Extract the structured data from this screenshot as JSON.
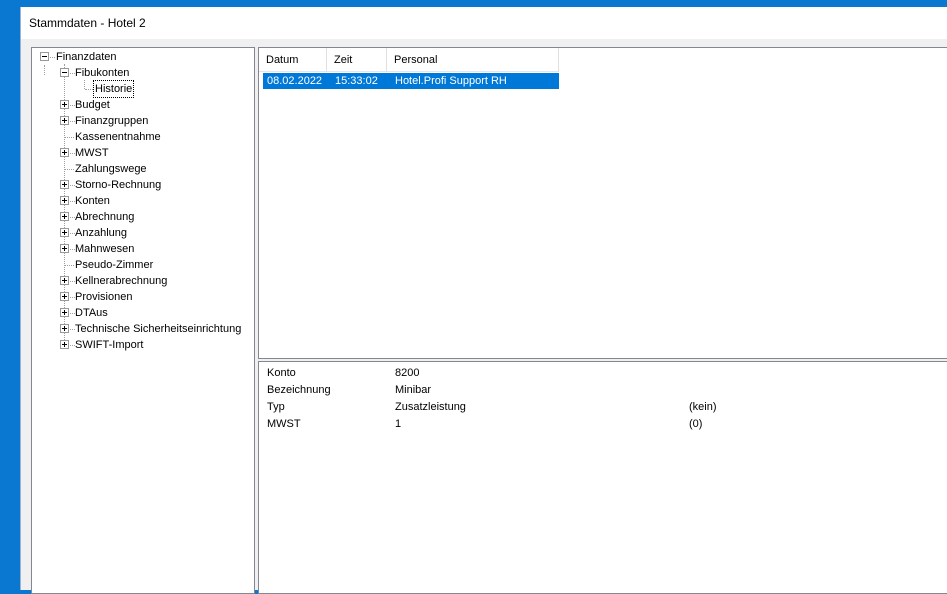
{
  "window": {
    "title": "Stammdaten - Hotel 2"
  },
  "tree": {
    "root": "Finanzdaten",
    "fibukonten": "Fibukonten",
    "historie": "Historie",
    "items": [
      {
        "label": "Budget",
        "expandable": true
      },
      {
        "label": "Finanzgruppen",
        "expandable": true
      },
      {
        "label": "Kassenentnahme",
        "expandable": false
      },
      {
        "label": "MWST",
        "expandable": true
      },
      {
        "label": "Zahlungswege",
        "expandable": false
      },
      {
        "label": "Storno-Rechnung",
        "expandable": true
      },
      {
        "label": "Konten",
        "expandable": true
      },
      {
        "label": "Abrechnung",
        "expandable": true
      },
      {
        "label": "Anzahlung",
        "expandable": true
      },
      {
        "label": "Mahnwesen",
        "expandable": true
      },
      {
        "label": "Pseudo-Zimmer",
        "expandable": false
      },
      {
        "label": "Kellnerabrechnung",
        "expandable": true
      },
      {
        "label": "Provisionen",
        "expandable": true
      },
      {
        "label": "DTAus",
        "expandable": true
      },
      {
        "label": "Technische Sicherheitseinrichtung",
        "expandable": true
      },
      {
        "label": "SWIFT-Import",
        "expandable": true
      }
    ]
  },
  "grid": {
    "columns": [
      "Datum",
      "Zeit",
      "Personal"
    ],
    "rows": [
      {
        "datum": "08.02.2022",
        "zeit": "15:33:02",
        "personal": "Hotel.Profi Support RH"
      }
    ]
  },
  "details": {
    "konto_label": "Konto",
    "konto_value": "8200",
    "bezeichnung_label": "Bezeichnung",
    "bezeichnung_value": "Minibar",
    "typ_label": "Typ",
    "typ_value": "Zusatzleistung",
    "typ_extra": "(kein)",
    "mwst_label": "MWST",
    "mwst_value": "1",
    "mwst_extra": "(0)"
  },
  "colors": {
    "selection": "#0078d7",
    "desktop": "#0a78d0"
  }
}
